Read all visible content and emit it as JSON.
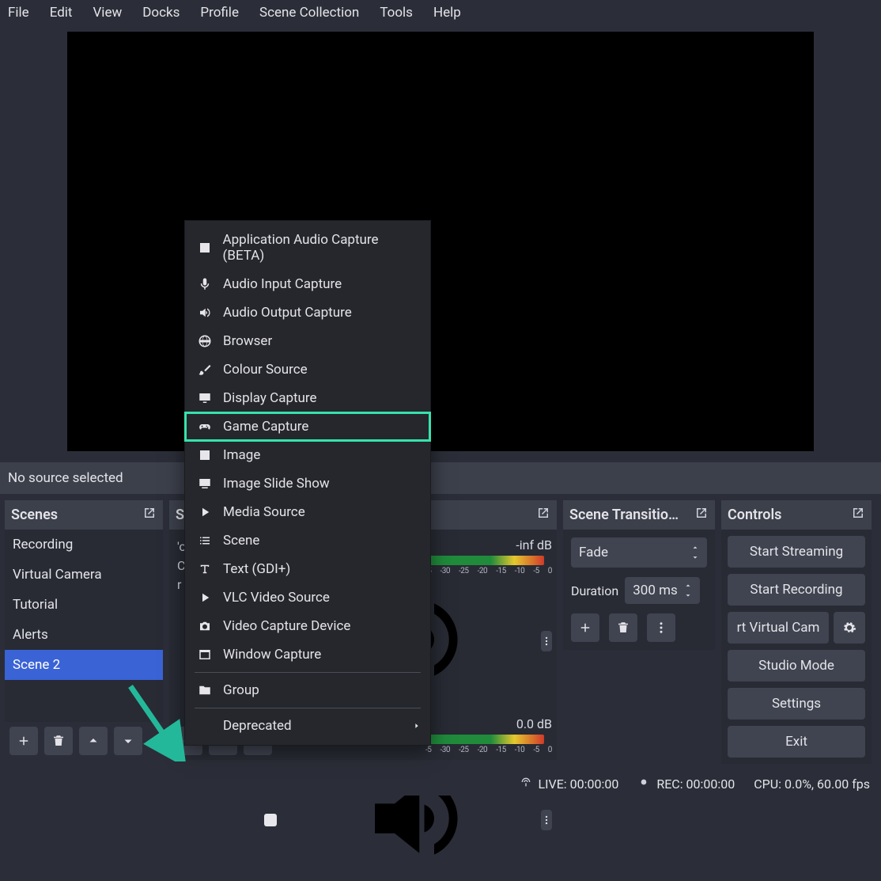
{
  "menubar": [
    "File",
    "Edit",
    "View",
    "Docks",
    "Profile",
    "Scene Collection",
    "Tools",
    "Help"
  ],
  "no_source_label": "No source selected",
  "scenes": {
    "title": "Scenes",
    "items": [
      "Recording",
      "Virtual Camera",
      "Tutorial",
      "Alerts",
      "Scene 2"
    ],
    "selected": 4
  },
  "sources": {
    "title_partial": "S…",
    "hint_lines": [
      "'ou",
      "Cl",
      "r rig"
    ]
  },
  "context_menu": {
    "items": [
      {
        "icon": "app-audio",
        "label": "Application Audio Capture (BETA)"
      },
      {
        "icon": "mic",
        "label": "Audio Input Capture"
      },
      {
        "icon": "speaker",
        "label": "Audio Output Capture"
      },
      {
        "icon": "globe",
        "label": "Browser"
      },
      {
        "icon": "brush",
        "label": "Colour Source"
      },
      {
        "icon": "monitor",
        "label": "Display Capture"
      },
      {
        "icon": "gamepad",
        "label": "Game Capture",
        "highlighted": true
      },
      {
        "icon": "image",
        "label": "Image"
      },
      {
        "icon": "slideshow",
        "label": "Image Slide Show"
      },
      {
        "icon": "play",
        "label": "Media Source"
      },
      {
        "icon": "list",
        "label": "Scene"
      },
      {
        "icon": "text",
        "label": "Text (GDI+)"
      },
      {
        "icon": "play",
        "label": "VLC Video Source"
      },
      {
        "icon": "camera",
        "label": "Video Capture Device"
      },
      {
        "icon": "window",
        "label": "Window Capture"
      },
      {
        "sep": true
      },
      {
        "icon": "folder",
        "label": "Group"
      },
      {
        "sep": true
      },
      {
        "icon": "",
        "label": "Deprecated",
        "submenu": true
      }
    ]
  },
  "audio": {
    "channel1_db": "-inf dB",
    "channel2_db": "0.0 dB",
    "scale": [
      "-5",
      "-30",
      "-25",
      "-20",
      "-15",
      "-10",
      "-5",
      "0"
    ]
  },
  "transitions": {
    "title": "Scene Transitio…",
    "selected": "Fade",
    "duration_label": "Duration",
    "duration_value": "300 ms"
  },
  "controls": {
    "title": "Controls",
    "buttons": [
      "Start Streaming",
      "Start Recording",
      "rt Virtual Cam",
      "Studio Mode",
      "Settings",
      "Exit"
    ]
  },
  "statusbar": {
    "live": "LIVE: 00:00:00",
    "rec": "REC: 00:00:00",
    "cpu": "CPU: 0.0%, 60.00 fps"
  }
}
